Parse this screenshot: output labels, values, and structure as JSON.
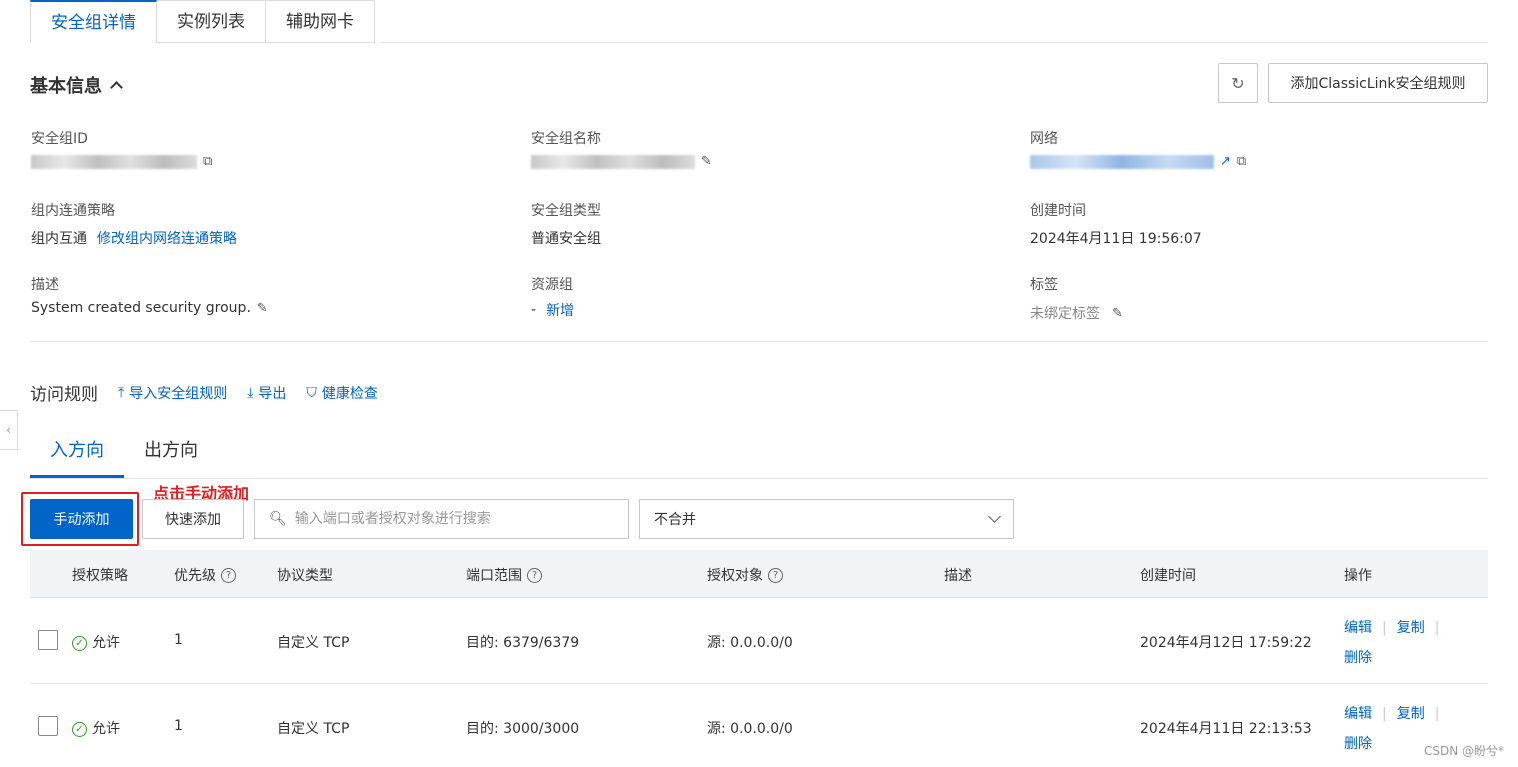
{
  "top_tabs": [
    {
      "label": "安全组详情"
    },
    {
      "label": "实例列表"
    },
    {
      "label": "辅助网卡"
    }
  ],
  "basic_info": {
    "title": "基本信息",
    "add_classiclink_label": "添加ClassicLink安全组规则",
    "fields": {
      "sg_id_label": "安全组ID",
      "sg_name_label": "安全组名称",
      "network_label": "网络",
      "policy_label": "组内连通策略",
      "policy_value": "组内互通",
      "policy_link": "修改组内网络连通策略",
      "sg_type_label": "安全组类型",
      "sg_type_value": "普通安全组",
      "created_label": "创建时间",
      "created_value": "2024年4月11日 19:56:07",
      "desc_label": "描述",
      "desc_value": "System created security group.",
      "rg_label": "资源组",
      "rg_value": "-",
      "rg_link": "新增",
      "tags_label": "标签",
      "tags_value": "未绑定标签"
    }
  },
  "rules": {
    "title": "访问规则",
    "import_label": "导入安全组规则",
    "export_label": "导出",
    "health_label": "健康检查",
    "dir_tabs": [
      {
        "label": "入方向"
      },
      {
        "label": "出方向"
      }
    ],
    "annotation": "点击手动添加",
    "manual_add_label": "手动添加",
    "quick_add_label": "快速添加",
    "search_placeholder": "输入端口或者授权对象进行搜索",
    "merge_select_value": "不合并",
    "columns": {
      "policy": "授权策略",
      "priority": "优先级",
      "protocol": "协议类型",
      "port": "端口范围",
      "target": "授权对象",
      "desc": "描述",
      "created": "创建时间",
      "ops": "操作"
    },
    "rows": [
      {
        "policy": "允许",
        "priority": "1",
        "protocol": "自定义 TCP",
        "port": "目的: 6379/6379",
        "target": "源: 0.0.0.0/0",
        "created": "2024年4月12日 17:59:22",
        "edit": "编辑",
        "copy": "复制",
        "delete": "删除"
      },
      {
        "policy": "允许",
        "priority": "1",
        "protocol": "自定义 TCP",
        "port": "目的: 3000/3000",
        "target": "源: 0.0.0.0/0",
        "created": "2024年4月11日 22:13:53",
        "edit": "编辑",
        "copy": "复制",
        "delete": "删除"
      }
    ]
  },
  "watermark": "CSDN @盼兮*",
  "colors": {
    "accent": "#0064c8",
    "annotation": "#e02020",
    "success": "#2ea121"
  }
}
